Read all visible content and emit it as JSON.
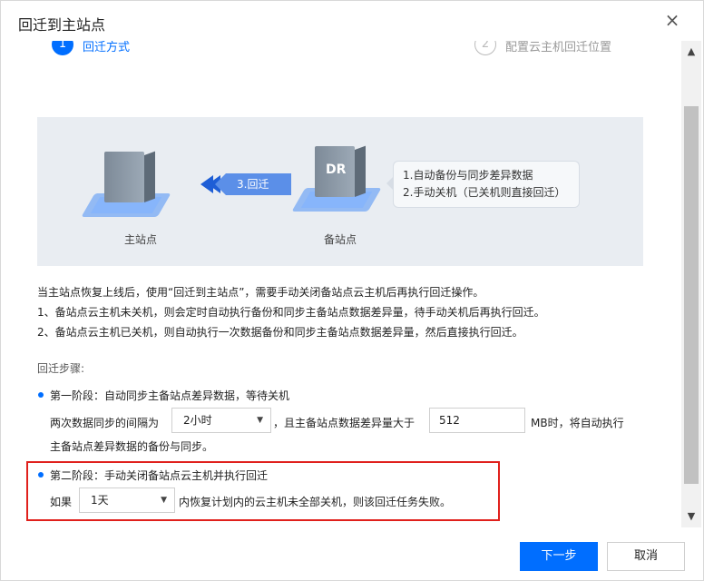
{
  "dialog": {
    "title": "回迁到主站点",
    "close_icon": "×"
  },
  "steps": [
    {
      "number": "1",
      "label": "回迁方式",
      "state": "active"
    },
    {
      "number": "2",
      "label": "配置云主机回迁位置",
      "state": "inactive"
    }
  ],
  "illustration": {
    "primary_label": "主站点",
    "backup_label": "备站点",
    "backup_badge": "DR",
    "arrow_label": "3.回迁",
    "bubble_line1": "1.自动备份与同步差异数据",
    "bubble_line2": "2.手动关机（已关机则直接回迁）"
  },
  "description": {
    "line1": "当主站点恢复上线后，使用“回迁到主站点”，需要手动关闭备站点云主机后再执行回迁操作。",
    "line2": "1、备站点云主机未关机，则会定时自动执行备份和同步主备站点数据差异量，待手动关机后再执行回迁。",
    "line3": "2、备站点云主机已关机，则自动执行一次数据备份和同步主备站点数据差异量，然后直接执行回迁。"
  },
  "procedure": {
    "title": "回迁步骤:",
    "phase1": {
      "title": "第一阶段：自动同步主备站点差异数据，等待关机",
      "prefix": "两次数据同步的间隔为",
      "interval_value": "2小时",
      "middle": "，且主备站点数据差异量大于",
      "threshold_value": "512",
      "suffix": "MB时，将自动执行",
      "line2": "主备站点差异数据的备份与同步。"
    },
    "phase2": {
      "title": "第二阶段：手动关闭备站点云主机并执行回迁",
      "prefix": "如果",
      "timeout_value": "1天",
      "suffix": "内恢复计划内的云主机未全部关机，则该回迁任务失败。"
    }
  },
  "footer": {
    "next_label": "下一步",
    "cancel_label": "取消"
  },
  "colors": {
    "primary": "#006eff",
    "highlight_border": "#e0201c"
  }
}
